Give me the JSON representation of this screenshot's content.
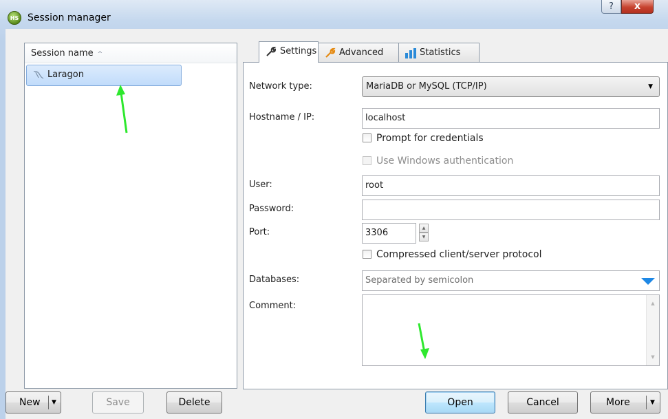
{
  "window": {
    "title": "Session manager",
    "icon_text": "HS",
    "help_glyph": "?",
    "close_glyph": "x"
  },
  "session_list": {
    "column_header": "Session name",
    "sort_glyph": "^",
    "items": [
      {
        "label": "Laragon",
        "selected": true
      }
    ]
  },
  "tabs": [
    {
      "label": "Settings",
      "icon": "wrench-icon",
      "active": true
    },
    {
      "label": "Advanced",
      "icon": "wrench-orange-icon",
      "active": false
    },
    {
      "label": "Statistics",
      "icon": "bar-chart-icon",
      "active": false
    }
  ],
  "settings": {
    "network_type_label": "Network type:",
    "network_type_value": "MariaDB or MySQL (TCP/IP)",
    "hostname_label": "Hostname / IP:",
    "hostname_value": "localhost",
    "prompt_credentials_label": "Prompt for credentials",
    "prompt_credentials_checked": false,
    "windows_auth_label": "Use Windows authentication",
    "windows_auth_checked": false,
    "user_label": "User:",
    "user_value": "root",
    "password_label": "Password:",
    "password_value": "",
    "port_label": "Port:",
    "port_value": "3306",
    "compressed_label": "Compressed client/server protocol",
    "compressed_checked": false,
    "databases_label": "Databases:",
    "databases_placeholder": "Separated by semicolon",
    "comment_label": "Comment:",
    "comment_value": ""
  },
  "buttons": {
    "new": "New",
    "save": "Save",
    "delete": "Delete",
    "open": "Open",
    "cancel": "Cancel",
    "more": "More"
  },
  "colors": {
    "annotation_arrow": "#2ee82e",
    "selection": "#c1dcfb",
    "dropdown_accent": "#1e88e5"
  }
}
